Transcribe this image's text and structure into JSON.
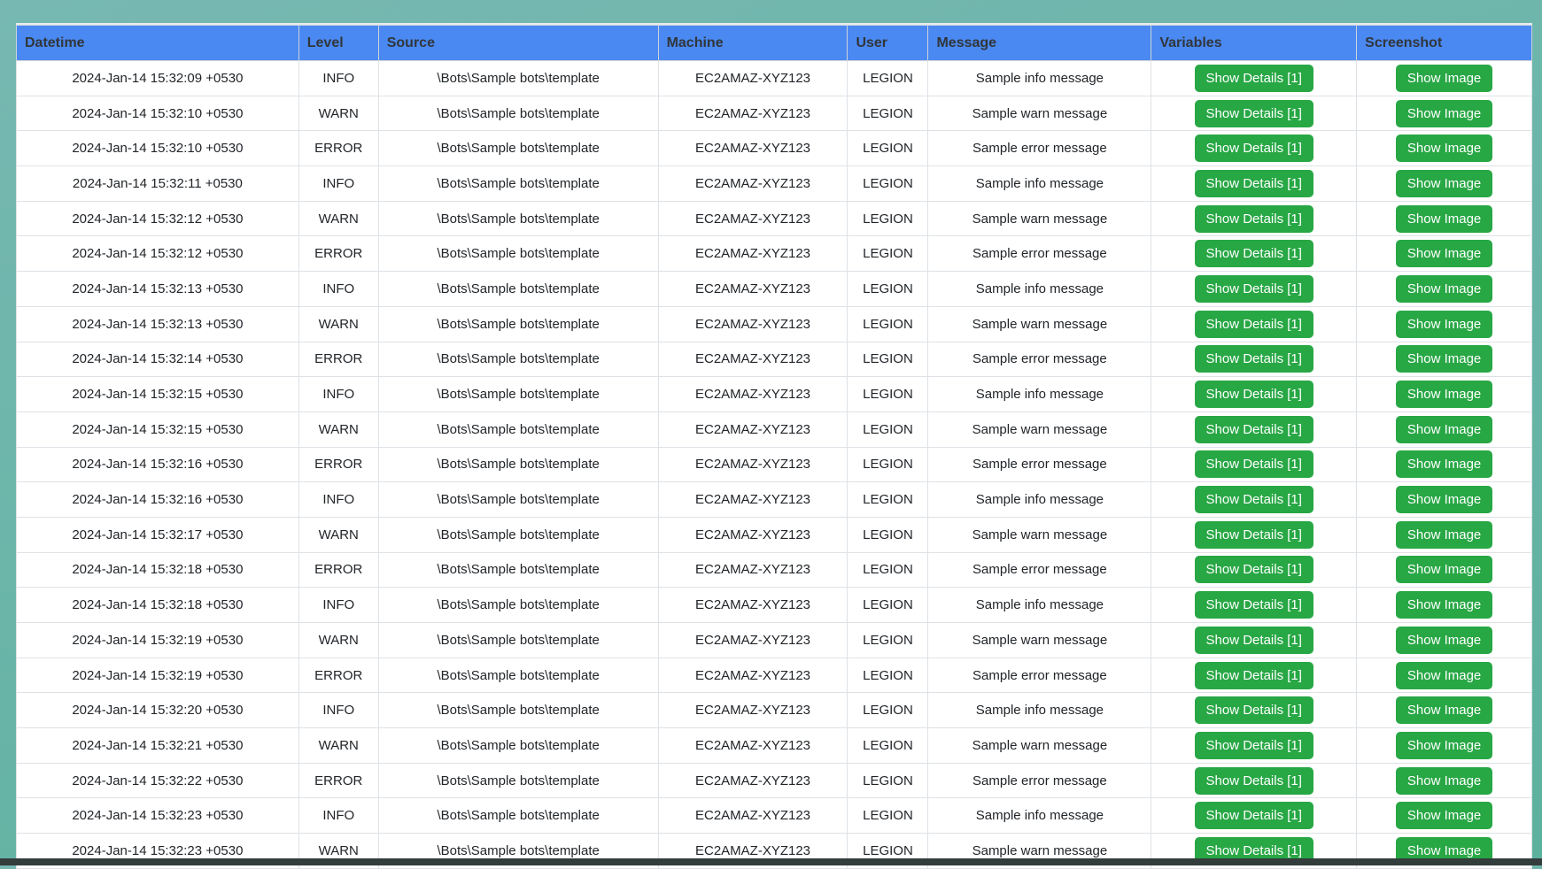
{
  "colors": {
    "background_teal": "#6fb5aa",
    "header_blue": "#4a89f2",
    "header_text": "#31363b",
    "button_green": "#28a745",
    "button_text": "#ffffff",
    "row_border": "#dee2e6",
    "cell_text": "#212529",
    "bottom_band": "#333d3b"
  },
  "table": {
    "columns": [
      {
        "key": "datetime",
        "label": "Datetime"
      },
      {
        "key": "level",
        "label": "Level"
      },
      {
        "key": "source",
        "label": "Source"
      },
      {
        "key": "machine",
        "label": "Machine"
      },
      {
        "key": "user",
        "label": "User"
      },
      {
        "key": "message",
        "label": "Message"
      },
      {
        "key": "variables",
        "label": "Variables"
      },
      {
        "key": "screenshot",
        "label": "Screenshot"
      }
    ],
    "rows": [
      {
        "datetime": "2024-Jan-14 15:32:09 +0530",
        "level": "INFO",
        "source": "\\Bots\\Sample bots\\template",
        "machine": "EC2AMAZ-XYZ123",
        "user": "LEGION",
        "message": "Sample info message",
        "variables_button": "Show Details [1]",
        "screenshot_button": "Show Image"
      },
      {
        "datetime": "2024-Jan-14 15:32:10 +0530",
        "level": "WARN",
        "source": "\\Bots\\Sample bots\\template",
        "machine": "EC2AMAZ-XYZ123",
        "user": "LEGION",
        "message": "Sample warn message",
        "variables_button": "Show Details [1]",
        "screenshot_button": "Show Image"
      },
      {
        "datetime": "2024-Jan-14 15:32:10 +0530",
        "level": "ERROR",
        "source": "\\Bots\\Sample bots\\template",
        "machine": "EC2AMAZ-XYZ123",
        "user": "LEGION",
        "message": "Sample error message",
        "variables_button": "Show Details [1]",
        "screenshot_button": "Show Image"
      },
      {
        "datetime": "2024-Jan-14 15:32:11 +0530",
        "level": "INFO",
        "source": "\\Bots\\Sample bots\\template",
        "machine": "EC2AMAZ-XYZ123",
        "user": "LEGION",
        "message": "Sample info message",
        "variables_button": "Show Details [1]",
        "screenshot_button": "Show Image"
      },
      {
        "datetime": "2024-Jan-14 15:32:12 +0530",
        "level": "WARN",
        "source": "\\Bots\\Sample bots\\template",
        "machine": "EC2AMAZ-XYZ123",
        "user": "LEGION",
        "message": "Sample warn message",
        "variables_button": "Show Details [1]",
        "screenshot_button": "Show Image"
      },
      {
        "datetime": "2024-Jan-14 15:32:12 +0530",
        "level": "ERROR",
        "source": "\\Bots\\Sample bots\\template",
        "machine": "EC2AMAZ-XYZ123",
        "user": "LEGION",
        "message": "Sample error message",
        "variables_button": "Show Details [1]",
        "screenshot_button": "Show Image"
      },
      {
        "datetime": "2024-Jan-14 15:32:13 +0530",
        "level": "INFO",
        "source": "\\Bots\\Sample bots\\template",
        "machine": "EC2AMAZ-XYZ123",
        "user": "LEGION",
        "message": "Sample info message",
        "variables_button": "Show Details [1]",
        "screenshot_button": "Show Image"
      },
      {
        "datetime": "2024-Jan-14 15:32:13 +0530",
        "level": "WARN",
        "source": "\\Bots\\Sample bots\\template",
        "machine": "EC2AMAZ-XYZ123",
        "user": "LEGION",
        "message": "Sample warn message",
        "variables_button": "Show Details [1]",
        "screenshot_button": "Show Image"
      },
      {
        "datetime": "2024-Jan-14 15:32:14 +0530",
        "level": "ERROR",
        "source": "\\Bots\\Sample bots\\template",
        "machine": "EC2AMAZ-XYZ123",
        "user": "LEGION",
        "message": "Sample error message",
        "variables_button": "Show Details [1]",
        "screenshot_button": "Show Image"
      },
      {
        "datetime": "2024-Jan-14 15:32:15 +0530",
        "level": "INFO",
        "source": "\\Bots\\Sample bots\\template",
        "machine": "EC2AMAZ-XYZ123",
        "user": "LEGION",
        "message": "Sample info message",
        "variables_button": "Show Details [1]",
        "screenshot_button": "Show Image"
      },
      {
        "datetime": "2024-Jan-14 15:32:15 +0530",
        "level": "WARN",
        "source": "\\Bots\\Sample bots\\template",
        "machine": "EC2AMAZ-XYZ123",
        "user": "LEGION",
        "message": "Sample warn message",
        "variables_button": "Show Details [1]",
        "screenshot_button": "Show Image"
      },
      {
        "datetime": "2024-Jan-14 15:32:16 +0530",
        "level": "ERROR",
        "source": "\\Bots\\Sample bots\\template",
        "machine": "EC2AMAZ-XYZ123",
        "user": "LEGION",
        "message": "Sample error message",
        "variables_button": "Show Details [1]",
        "screenshot_button": "Show Image"
      },
      {
        "datetime": "2024-Jan-14 15:32:16 +0530",
        "level": "INFO",
        "source": "\\Bots\\Sample bots\\template",
        "machine": "EC2AMAZ-XYZ123",
        "user": "LEGION",
        "message": "Sample info message",
        "variables_button": "Show Details [1]",
        "screenshot_button": "Show Image"
      },
      {
        "datetime": "2024-Jan-14 15:32:17 +0530",
        "level": "WARN",
        "source": "\\Bots\\Sample bots\\template",
        "machine": "EC2AMAZ-XYZ123",
        "user": "LEGION",
        "message": "Sample warn message",
        "variables_button": "Show Details [1]",
        "screenshot_button": "Show Image"
      },
      {
        "datetime": "2024-Jan-14 15:32:18 +0530",
        "level": "ERROR",
        "source": "\\Bots\\Sample bots\\template",
        "machine": "EC2AMAZ-XYZ123",
        "user": "LEGION",
        "message": "Sample error message",
        "variables_button": "Show Details [1]",
        "screenshot_button": "Show Image"
      },
      {
        "datetime": "2024-Jan-14 15:32:18 +0530",
        "level": "INFO",
        "source": "\\Bots\\Sample bots\\template",
        "machine": "EC2AMAZ-XYZ123",
        "user": "LEGION",
        "message": "Sample info message",
        "variables_button": "Show Details [1]",
        "screenshot_button": "Show Image"
      },
      {
        "datetime": "2024-Jan-14 15:32:19 +0530",
        "level": "WARN",
        "source": "\\Bots\\Sample bots\\template",
        "machine": "EC2AMAZ-XYZ123",
        "user": "LEGION",
        "message": "Sample warn message",
        "variables_button": "Show Details [1]",
        "screenshot_button": "Show Image"
      },
      {
        "datetime": "2024-Jan-14 15:32:19 +0530",
        "level": "ERROR",
        "source": "\\Bots\\Sample bots\\template",
        "machine": "EC2AMAZ-XYZ123",
        "user": "LEGION",
        "message": "Sample error message",
        "variables_button": "Show Details [1]",
        "screenshot_button": "Show Image"
      },
      {
        "datetime": "2024-Jan-14 15:32:20 +0530",
        "level": "INFO",
        "source": "\\Bots\\Sample bots\\template",
        "machine": "EC2AMAZ-XYZ123",
        "user": "LEGION",
        "message": "Sample info message",
        "variables_button": "Show Details [1]",
        "screenshot_button": "Show Image"
      },
      {
        "datetime": "2024-Jan-14 15:32:21 +0530",
        "level": "WARN",
        "source": "\\Bots\\Sample bots\\template",
        "machine": "EC2AMAZ-XYZ123",
        "user": "LEGION",
        "message": "Sample warn message",
        "variables_button": "Show Details [1]",
        "screenshot_button": "Show Image"
      },
      {
        "datetime": "2024-Jan-14 15:32:22 +0530",
        "level": "ERROR",
        "source": "\\Bots\\Sample bots\\template",
        "machine": "EC2AMAZ-XYZ123",
        "user": "LEGION",
        "message": "Sample error message",
        "variables_button": "Show Details [1]",
        "screenshot_button": "Show Image"
      },
      {
        "datetime": "2024-Jan-14 15:32:23 +0530",
        "level": "INFO",
        "source": "\\Bots\\Sample bots\\template",
        "machine": "EC2AMAZ-XYZ123",
        "user": "LEGION",
        "message": "Sample info message",
        "variables_button": "Show Details [1]",
        "screenshot_button": "Show Image"
      },
      {
        "datetime": "2024-Jan-14 15:32:23 +0530",
        "level": "WARN",
        "source": "\\Bots\\Sample bots\\template",
        "machine": "EC2AMAZ-XYZ123",
        "user": "LEGION",
        "message": "Sample warn message",
        "variables_button": "Show Details [1]",
        "screenshot_button": "Show Image"
      }
    ]
  }
}
